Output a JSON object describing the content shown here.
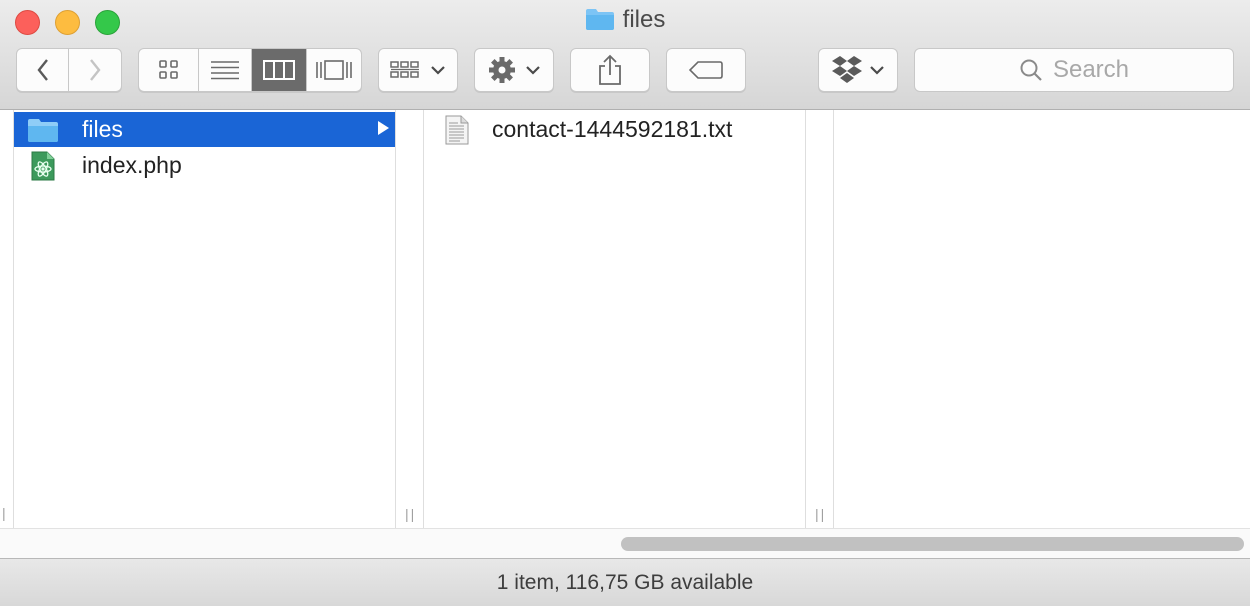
{
  "window": {
    "title": "files",
    "title_icon": "folder-icon"
  },
  "toolbar": {
    "back": "chevron-left-icon",
    "forward": "chevron-right-icon",
    "view_modes": [
      "icon-view-icon",
      "list-view-icon",
      "column-view-icon",
      "cover-flow-view-icon"
    ],
    "selected_view": "column-view",
    "arrange": "arrange-icon",
    "action": "gear-icon",
    "share": "share-icon",
    "tags": "tag-icon",
    "dropbox": "dropbox-icon",
    "search_placeholder": "Search"
  },
  "columns": [
    {
      "items": [
        {
          "label": "files",
          "icon": "folder-icon",
          "selected": true,
          "has_children": true
        },
        {
          "label": "index.php",
          "icon": "php-file-icon",
          "selected": false
        }
      ]
    },
    {
      "items": [
        {
          "label": "contact-1444592181.txt",
          "icon": "text-file-icon",
          "selected": false
        }
      ]
    },
    {
      "items": []
    }
  ],
  "status": {
    "text": "1 item, 116,75 GB available"
  },
  "colors": {
    "selection": "#1a65d6",
    "close": "#fc605b",
    "minimize": "#fdbc40",
    "maximize": "#34c84a",
    "folder": "#5fb7f0"
  }
}
